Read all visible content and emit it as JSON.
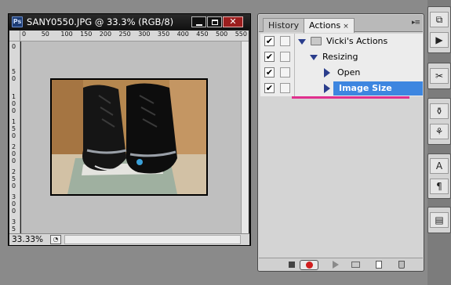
{
  "document": {
    "title": "SANY0550.JPG @ 33.3% (RGB/8)",
    "app_icon": "Ps",
    "zoom": "33.33%",
    "ruler_h_labels": [
      "0",
      "50",
      "100",
      "150",
      "200",
      "250",
      "300",
      "350",
      "400",
      "450",
      "500",
      "550"
    ],
    "ruler_v_labels": [
      "0",
      "50",
      "100",
      "150",
      "200",
      "250",
      "300",
      "350"
    ],
    "buttons": {
      "minimize": "minimize-icon",
      "maximize": "maximize-icon",
      "close": "✕"
    }
  },
  "panel": {
    "tabs": [
      {
        "label": "History"
      },
      {
        "label": "Actions",
        "close": "×"
      }
    ],
    "menu_glyph": "▸≡",
    "rows": [
      {
        "label": "Vicki's Actions",
        "checked": "✔"
      },
      {
        "label": "Resizing",
        "checked": "✔"
      },
      {
        "label": "Open",
        "checked": "✔"
      },
      {
        "label": "Image Size",
        "checked": "✔",
        "selected": true
      }
    ],
    "footer_icons": [
      "stop-icon",
      "record-icon",
      "play-icon",
      "new-set-icon",
      "new-action-icon",
      "trash-icon"
    ]
  },
  "dock": {
    "icons": [
      "history-icon",
      "actions-icon",
      "tools-icon",
      "clone-icon",
      "brush-icon",
      "character-icon",
      "paragraph-icon",
      "layer-comps-icon"
    ],
    "glyphs": [
      "⧉",
      "▶",
      "✂",
      "⚱",
      "⚘",
      "A",
      "¶",
      "▤"
    ]
  },
  "colors": {
    "selection": "#3d86e0",
    "underline": "#e0308e",
    "record": "#d01d1d"
  }
}
